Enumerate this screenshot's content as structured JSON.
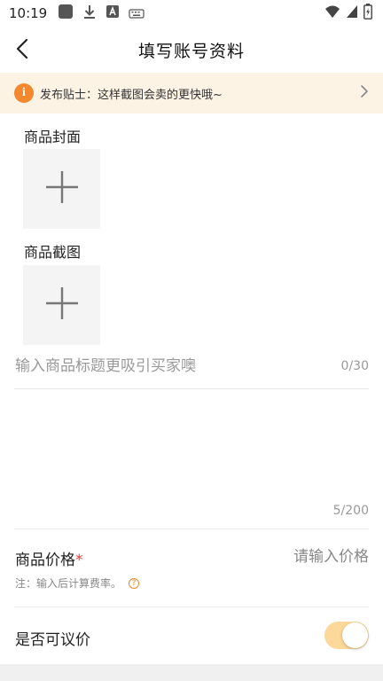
{
  "status_bar": {
    "time": "10:19",
    "left_icons": [
      "app-square-icon",
      "download-icon",
      "text-a-icon",
      "keyboard-icon"
    ],
    "right_icons": [
      "wifi-icon",
      "signal-icon",
      "battery-icon"
    ]
  },
  "nav": {
    "title": "填写账号资料",
    "back_icon": "back-chevron-icon"
  },
  "tip": {
    "icon_glyph": "i",
    "text": "发布贴士：这样截图会卖的更快哦~",
    "accent_color": "#f2892e",
    "background": "#fdf3e4"
  },
  "cover": {
    "label": "商品封面"
  },
  "screenshot": {
    "label": "商品截图"
  },
  "title_field": {
    "placeholder": "输入商品标题更吸引买家噢",
    "value": "",
    "count": "0/30"
  },
  "description": {
    "value": "",
    "count": "5/200"
  },
  "price": {
    "label": "商品价格",
    "required_mark": "*",
    "placeholder": "请输入价格",
    "note": "注：输入后计算费率。",
    "help_glyph": "?"
  },
  "negotiable": {
    "label": "是否可议价",
    "enabled": true,
    "toggle_color": "#fcd99a"
  }
}
